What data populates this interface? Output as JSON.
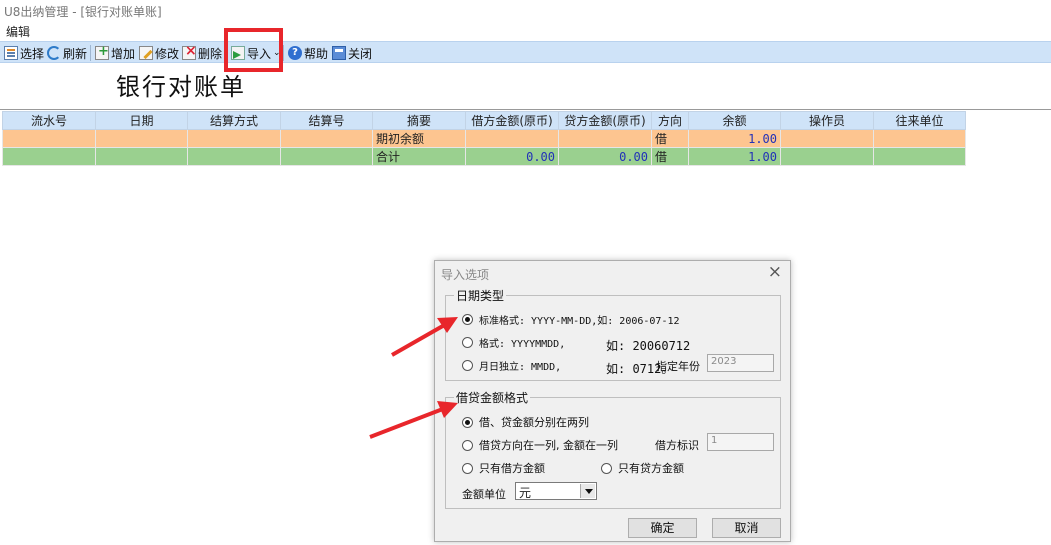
{
  "window": {
    "title": "U8出纳管理 - [银行对账单账]"
  },
  "menu": {
    "edit": "编辑"
  },
  "toolbar": {
    "select": "选择",
    "refresh": "刷新",
    "add": "增加",
    "edit": "修改",
    "delete": "删除",
    "import": "导入",
    "help": "帮助",
    "close": "关闭"
  },
  "page": {
    "title": "银行对账单"
  },
  "table": {
    "headers": [
      "流水号",
      "日期",
      "结算方式",
      "结算号",
      "摘要",
      "借方金额(原币)",
      "贷方金额(原币)",
      "方向",
      "余额",
      "操作员",
      "往来单位"
    ],
    "rows": [
      {
        "summary": "期初余额",
        "debit": "",
        "credit": "",
        "direction": "借",
        "balance": "1.00"
      },
      {
        "summary": "合计",
        "debit": "0.00",
        "credit": "0.00",
        "direction": "借",
        "balance": "1.00"
      }
    ]
  },
  "dialog": {
    "title": "导入选项",
    "date_group": {
      "legend": "日期类型",
      "opt_standard": "标准格式: YYYY-MM-DD,如: 2006-07-12",
      "opt_compact": "格式: YYYYMMDD,",
      "opt_compact_example": "如: 20060712",
      "opt_monthday": "月日独立: MMDD,",
      "opt_monthday_example": "如: 0712。",
      "year_label": "指定年份",
      "year_value": "2023",
      "selected": "standard"
    },
    "amount_group": {
      "legend": "借贷金额格式",
      "opt_two_columns": "借、贷金额分别在两列",
      "opt_one_column": "借贷方向在一列, 金额在一列",
      "debit_flag_label": "借方标识",
      "debit_flag_value": "1",
      "opt_debit_only": "只有借方金额",
      "opt_credit_only": "只有贷方金额",
      "unit_label": "金额单位",
      "unit_value": "元",
      "selected": "two_columns"
    },
    "ok": "确定",
    "cancel": "取消"
  },
  "colors": {
    "toolbar_bg": "#cfe3f8",
    "row_opening": "#fdc590",
    "row_total": "#9ad08f",
    "highlight": "#e8262b",
    "amount_text": "#2231b8"
  }
}
